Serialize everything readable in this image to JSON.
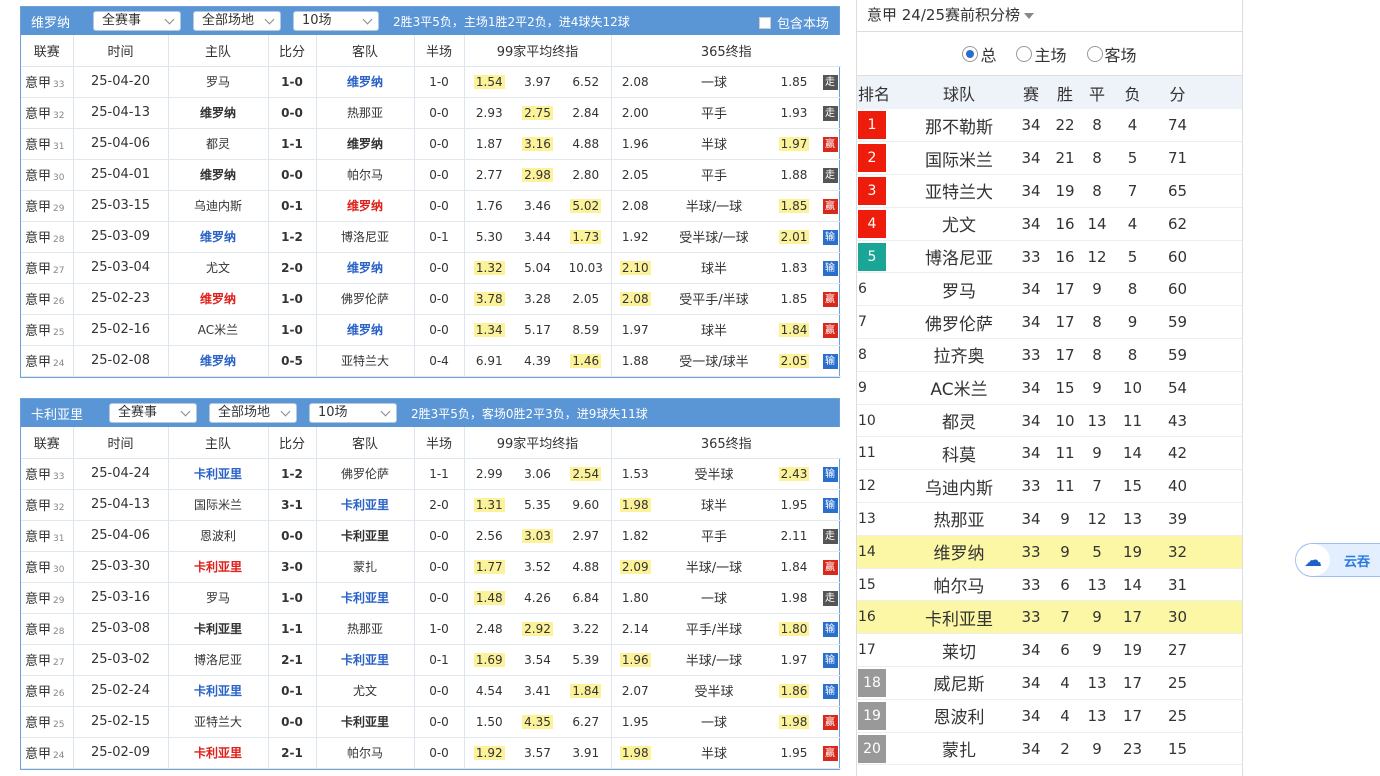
{
  "panel1": {
    "team": "维罗纳",
    "sel_comp": "全赛事",
    "sel_venue": "全部场地",
    "sel_count": "10场",
    "summary": "2胜3平5负，主场1胜2平2负，进4球失12球",
    "include_label": "包含本场",
    "matches": [
      {
        "league": "意甲",
        "round": "33",
        "date": "25-04-20",
        "home": "罗马",
        "home_style": "normal",
        "score": "1-0",
        "away": "维罗纳",
        "away_style": "blue",
        "half": "1-0",
        "o1": "1.54",
        "o1h": true,
        "o2": "3.97",
        "o2h": false,
        "o3": "6.52",
        "o3h": false,
        "a1": "2.08",
        "a1h": false,
        "hc": "一球",
        "a2": "1.85",
        "a2h": false,
        "res": "走",
        "res_type": "zou"
      },
      {
        "league": "意甲",
        "round": "32",
        "date": "25-04-13",
        "home": "维罗纳",
        "home_style": "bold",
        "score": "0-0",
        "away": "热那亚",
        "away_style": "normal",
        "half": "0-0",
        "o1": "2.93",
        "o1h": false,
        "o2": "2.75",
        "o2h": true,
        "o3": "2.84",
        "o3h": false,
        "a1": "2.00",
        "a1h": false,
        "hc": "平手",
        "a2": "1.93",
        "a2h": false,
        "res": "走",
        "res_type": "zou"
      },
      {
        "league": "意甲",
        "round": "31",
        "date": "25-04-06",
        "home": "都灵",
        "home_style": "normal",
        "score": "1-1",
        "away": "维罗纳",
        "away_style": "bold",
        "half": "0-0",
        "o1": "1.87",
        "o1h": false,
        "o2": "3.16",
        "o2h": true,
        "o3": "4.88",
        "o3h": false,
        "a1": "1.96",
        "a1h": false,
        "hc": "半球",
        "a2": "1.97",
        "a2h": true,
        "res": "赢",
        "res_type": "ying"
      },
      {
        "league": "意甲",
        "round": "30",
        "date": "25-04-01",
        "home": "维罗纳",
        "home_style": "bold",
        "score": "0-0",
        "away": "帕尔马",
        "away_style": "normal",
        "half": "0-0",
        "o1": "2.77",
        "o1h": false,
        "o2": "2.98",
        "o2h": true,
        "o3": "2.80",
        "o3h": false,
        "a1": "2.05",
        "a1h": false,
        "hc": "平手",
        "a2": "1.88",
        "a2h": false,
        "res": "走",
        "res_type": "zou"
      },
      {
        "league": "意甲",
        "round": "29",
        "date": "25-03-15",
        "home": "乌迪内斯",
        "home_style": "normal",
        "score": "0-1",
        "away": "维罗纳",
        "away_style": "red",
        "half": "0-0",
        "o1": "1.76",
        "o1h": false,
        "o2": "3.46",
        "o2h": false,
        "o3": "5.02",
        "o3h": true,
        "a1": "2.08",
        "a1h": false,
        "hc": "半球/一球",
        "a2": "1.85",
        "a2h": true,
        "res": "赢",
        "res_type": "ying"
      },
      {
        "league": "意甲",
        "round": "28",
        "date": "25-03-09",
        "home": "维罗纳",
        "home_style": "blue",
        "score": "1-2",
        "away": "博洛尼亚",
        "away_style": "normal",
        "half": "0-1",
        "o1": "5.30",
        "o1h": false,
        "o2": "3.44",
        "o2h": false,
        "o3": "1.73",
        "o3h": true,
        "a1": "1.92",
        "a1h": false,
        "hc": "受半球/一球",
        "a2": "2.01",
        "a2h": true,
        "res": "输",
        "res_type": "shu"
      },
      {
        "league": "意甲",
        "round": "27",
        "date": "25-03-04",
        "home": "尤文",
        "home_style": "normal",
        "score": "2-0",
        "away": "维罗纳",
        "away_style": "blue",
        "half": "0-0",
        "o1": "1.32",
        "o1h": true,
        "o2": "5.04",
        "o2h": false,
        "o3": "10.03",
        "o3h": false,
        "a1": "2.10",
        "a1h": true,
        "hc": "球半",
        "a2": "1.83",
        "a2h": false,
        "res": "输",
        "res_type": "shu"
      },
      {
        "league": "意甲",
        "round": "26",
        "date": "25-02-23",
        "home": "维罗纳",
        "home_style": "red",
        "score": "1-0",
        "away": "佛罗伦萨",
        "away_style": "normal",
        "half": "0-0",
        "o1": "3.78",
        "o1h": true,
        "o2": "3.28",
        "o2h": false,
        "o3": "2.05",
        "o3h": false,
        "a1": "2.08",
        "a1h": true,
        "hc": "受平手/半球",
        "a2": "1.85",
        "a2h": false,
        "res": "赢",
        "res_type": "ying"
      },
      {
        "league": "意甲",
        "round": "25",
        "date": "25-02-16",
        "home": "AC米兰",
        "home_style": "normal",
        "score": "1-0",
        "away": "维罗纳",
        "away_style": "blue",
        "half": "0-0",
        "o1": "1.34",
        "o1h": true,
        "o2": "5.17",
        "o2h": false,
        "o3": "8.59",
        "o3h": false,
        "a1": "1.97",
        "a1h": false,
        "hc": "球半",
        "a2": "1.84",
        "a2h": true,
        "res": "赢",
        "res_type": "ying"
      },
      {
        "league": "意甲",
        "round": "24",
        "date": "25-02-08",
        "home": "维罗纳",
        "home_style": "blue",
        "score": "0-5",
        "away": "亚特兰大",
        "away_style": "normal",
        "half": "0-4",
        "o1": "6.91",
        "o1h": false,
        "o2": "4.39",
        "o2h": false,
        "o3": "1.46",
        "o3h": true,
        "a1": "1.88",
        "a1h": false,
        "hc": "受一球/球半",
        "a2": "2.05",
        "a2h": true,
        "res": "输",
        "res_type": "shu"
      }
    ]
  },
  "panel2": {
    "team": "卡利亚里",
    "sel_comp": "全赛事",
    "sel_venue": "全部场地",
    "sel_count": "10场",
    "summary": "2胜3平5负，客场0胜2平3负，进9球失11球",
    "matches": [
      {
        "league": "意甲",
        "round": "33",
        "date": "25-04-24",
        "home": "卡利亚里",
        "home_style": "blue",
        "score": "1-2",
        "away": "佛罗伦萨",
        "away_style": "normal",
        "half": "1-1",
        "o1": "2.99",
        "o1h": false,
        "o2": "3.06",
        "o2h": false,
        "o3": "2.54",
        "o3h": true,
        "a1": "1.53",
        "a1h": false,
        "hc": "受半球",
        "a2": "2.43",
        "a2h": true,
        "res": "输",
        "res_type": "shu"
      },
      {
        "league": "意甲",
        "round": "32",
        "date": "25-04-13",
        "home": "国际米兰",
        "home_style": "normal",
        "score": "3-1",
        "away": "卡利亚里",
        "away_style": "blue",
        "half": "2-0",
        "o1": "1.31",
        "o1h": true,
        "o2": "5.35",
        "o2h": false,
        "o3": "9.60",
        "o3h": false,
        "a1": "1.98",
        "a1h": true,
        "hc": "球半",
        "a2": "1.95",
        "a2h": false,
        "res": "输",
        "res_type": "shu"
      },
      {
        "league": "意甲",
        "round": "31",
        "date": "25-04-06",
        "home": "恩波利",
        "home_style": "normal",
        "score": "0-0",
        "away": "卡利亚里",
        "away_style": "bold",
        "half": "0-0",
        "o1": "2.56",
        "o1h": false,
        "o2": "3.03",
        "o2h": true,
        "o3": "2.97",
        "o3h": false,
        "a1": "1.82",
        "a1h": false,
        "hc": "平手",
        "a2": "2.11",
        "a2h": false,
        "res": "走",
        "res_type": "zou"
      },
      {
        "league": "意甲",
        "round": "30",
        "date": "25-03-30",
        "home": "卡利亚里",
        "home_style": "red",
        "score": "3-0",
        "away": "蒙扎",
        "away_style": "normal",
        "half": "0-0",
        "o1": "1.77",
        "o1h": true,
        "o2": "3.52",
        "o2h": false,
        "o3": "4.88",
        "o3h": false,
        "a1": "2.09",
        "a1h": true,
        "hc": "半球/一球",
        "a2": "1.84",
        "a2h": false,
        "res": "赢",
        "res_type": "ying"
      },
      {
        "league": "意甲",
        "round": "29",
        "date": "25-03-16",
        "home": "罗马",
        "home_style": "normal",
        "score": "1-0",
        "away": "卡利亚里",
        "away_style": "blue",
        "half": "0-0",
        "o1": "1.48",
        "o1h": true,
        "o2": "4.26",
        "o2h": false,
        "o3": "6.84",
        "o3h": false,
        "a1": "1.80",
        "a1h": false,
        "hc": "一球",
        "a2": "1.98",
        "a2h": false,
        "res": "走",
        "res_type": "zou"
      },
      {
        "league": "意甲",
        "round": "28",
        "date": "25-03-08",
        "home": "卡利亚里",
        "home_style": "bold",
        "score": "1-1",
        "away": "热那亚",
        "away_style": "normal",
        "half": "1-0",
        "o1": "2.48",
        "o1h": false,
        "o2": "2.92",
        "o2h": true,
        "o3": "3.22",
        "o3h": false,
        "a1": "2.14",
        "a1h": false,
        "hc": "平手/半球",
        "a2": "1.80",
        "a2h": true,
        "res": "输",
        "res_type": "shu"
      },
      {
        "league": "意甲",
        "round": "27",
        "date": "25-03-02",
        "home": "博洛尼亚",
        "home_style": "normal",
        "score": "2-1",
        "away": "卡利亚里",
        "away_style": "blue",
        "half": "0-1",
        "o1": "1.69",
        "o1h": true,
        "o2": "3.54",
        "o2h": false,
        "o3": "5.39",
        "o3h": false,
        "a1": "1.96",
        "a1h": true,
        "hc": "半球/一球",
        "a2": "1.97",
        "a2h": false,
        "res": "输",
        "res_type": "shu"
      },
      {
        "league": "意甲",
        "round": "26",
        "date": "25-02-24",
        "home": "卡利亚里",
        "home_style": "blue",
        "score": "0-1",
        "away": "尤文",
        "away_style": "normal",
        "half": "0-0",
        "o1": "4.54",
        "o1h": false,
        "o2": "3.41",
        "o2h": false,
        "o3": "1.84",
        "o3h": true,
        "a1": "2.07",
        "a1h": false,
        "hc": "受半球",
        "a2": "1.86",
        "a2h": true,
        "res": "输",
        "res_type": "shu"
      },
      {
        "league": "意甲",
        "round": "25",
        "date": "25-02-15",
        "home": "亚特兰大",
        "home_style": "normal",
        "score": "0-0",
        "away": "卡利亚里",
        "away_style": "bold",
        "half": "0-0",
        "o1": "1.50",
        "o1h": false,
        "o2": "4.35",
        "o2h": true,
        "o3": "6.27",
        "o3h": false,
        "a1": "1.95",
        "a1h": false,
        "hc": "一球",
        "a2": "1.98",
        "a2h": true,
        "res": "赢",
        "res_type": "ying"
      },
      {
        "league": "意甲",
        "round": "24",
        "date": "25-02-09",
        "home": "卡利亚里",
        "home_style": "red",
        "score": "2-1",
        "away": "帕尔马",
        "away_style": "normal",
        "half": "0-0",
        "o1": "1.92",
        "o1h": true,
        "o2": "3.57",
        "o2h": false,
        "o3": "3.91",
        "o3h": false,
        "a1": "1.98",
        "a1h": true,
        "hc": "半球",
        "a2": "1.95",
        "a2h": false,
        "res": "赢",
        "res_type": "ying"
      }
    ]
  },
  "match_headers": {
    "league": "联赛",
    "time": "时间",
    "home": "主队",
    "score": "比分",
    "away": "客队",
    "half": "半场",
    "avg": "99家平均终指",
    "b365": "365终指"
  },
  "standings": {
    "title": "意甲  24/25赛前积分榜",
    "radio_total": "总",
    "radio_home": "主场",
    "radio_away": "客场",
    "headers": {
      "rank": "排名",
      "team": "球队",
      "played": "赛",
      "win": "胜",
      "draw": "平",
      "loss": "负",
      "pts": "分"
    },
    "rows": [
      {
        "rank": "1",
        "team": "那不勒斯",
        "p": "34",
        "w": "22",
        "d": "8",
        "l": "4",
        "pts": "74",
        "mark": "red",
        "hl": false
      },
      {
        "rank": "2",
        "team": "国际米兰",
        "p": "34",
        "w": "21",
        "d": "8",
        "l": "5",
        "pts": "71",
        "mark": "red",
        "hl": false
      },
      {
        "rank": "3",
        "team": "亚特兰大",
        "p": "34",
        "w": "19",
        "d": "8",
        "l": "7",
        "pts": "65",
        "mark": "red",
        "hl": false
      },
      {
        "rank": "4",
        "team": "尤文",
        "p": "34",
        "w": "16",
        "d": "14",
        "l": "4",
        "pts": "62",
        "mark": "red",
        "hl": false
      },
      {
        "rank": "5",
        "team": "博洛尼亚",
        "p": "33",
        "w": "16",
        "d": "12",
        "l": "5",
        "pts": "60",
        "mark": "teal",
        "hl": false
      },
      {
        "rank": "6",
        "team": "罗马",
        "p": "34",
        "w": "17",
        "d": "9",
        "l": "8",
        "pts": "60",
        "mark": "",
        "hl": false
      },
      {
        "rank": "7",
        "team": "佛罗伦萨",
        "p": "34",
        "w": "17",
        "d": "8",
        "l": "9",
        "pts": "59",
        "mark": "",
        "hl": false
      },
      {
        "rank": "8",
        "team": "拉齐奥",
        "p": "33",
        "w": "17",
        "d": "8",
        "l": "8",
        "pts": "59",
        "mark": "",
        "hl": false
      },
      {
        "rank": "9",
        "team": "AC米兰",
        "p": "34",
        "w": "15",
        "d": "9",
        "l": "10",
        "pts": "54",
        "mark": "",
        "hl": false
      },
      {
        "rank": "10",
        "team": "都灵",
        "p": "34",
        "w": "10",
        "d": "13",
        "l": "11",
        "pts": "43",
        "mark": "",
        "hl": false
      },
      {
        "rank": "11",
        "team": "科莫",
        "p": "34",
        "w": "11",
        "d": "9",
        "l": "14",
        "pts": "42",
        "mark": "",
        "hl": false
      },
      {
        "rank": "12",
        "team": "乌迪内斯",
        "p": "33",
        "w": "11",
        "d": "7",
        "l": "15",
        "pts": "40",
        "mark": "",
        "hl": false
      },
      {
        "rank": "13",
        "team": "热那亚",
        "p": "34",
        "w": "9",
        "d": "12",
        "l": "13",
        "pts": "39",
        "mark": "",
        "hl": false
      },
      {
        "rank": "14",
        "team": "维罗纳",
        "p": "33",
        "w": "9",
        "d": "5",
        "l": "19",
        "pts": "32",
        "mark": "",
        "hl": true
      },
      {
        "rank": "15",
        "team": "帕尔马",
        "p": "33",
        "w": "6",
        "d": "13",
        "l": "14",
        "pts": "31",
        "mark": "",
        "hl": false
      },
      {
        "rank": "16",
        "team": "卡利亚里",
        "p": "33",
        "w": "7",
        "d": "9",
        "l": "17",
        "pts": "30",
        "mark": "",
        "hl": true
      },
      {
        "rank": "17",
        "team": "莱切",
        "p": "34",
        "w": "6",
        "d": "9",
        "l": "19",
        "pts": "27",
        "mark": "",
        "hl": false
      },
      {
        "rank": "18",
        "team": "威尼斯",
        "p": "34",
        "w": "4",
        "d": "13",
        "l": "17",
        "pts": "25",
        "mark": "grey",
        "hl": false
      },
      {
        "rank": "19",
        "team": "恩波利",
        "p": "34",
        "w": "4",
        "d": "13",
        "l": "17",
        "pts": "25",
        "mark": "grey",
        "hl": false
      },
      {
        "rank": "20",
        "team": "蒙扎",
        "p": "34",
        "w": "2",
        "d": "9",
        "l": "23",
        "pts": "15",
        "mark": "grey",
        "hl": false
      }
    ]
  },
  "widget": {
    "label": "云吞"
  },
  "colors": {
    "header_blue": "#5a95d6",
    "highlight_yellow": "#fbf29a",
    "win_red": "#d9281c",
    "loss_blue": "#2a6fcc",
    "draw_grey": "#555555",
    "rank_red": "#ee1c0a",
    "rank_teal": "#1aa596",
    "rank_grey": "#999999"
  }
}
